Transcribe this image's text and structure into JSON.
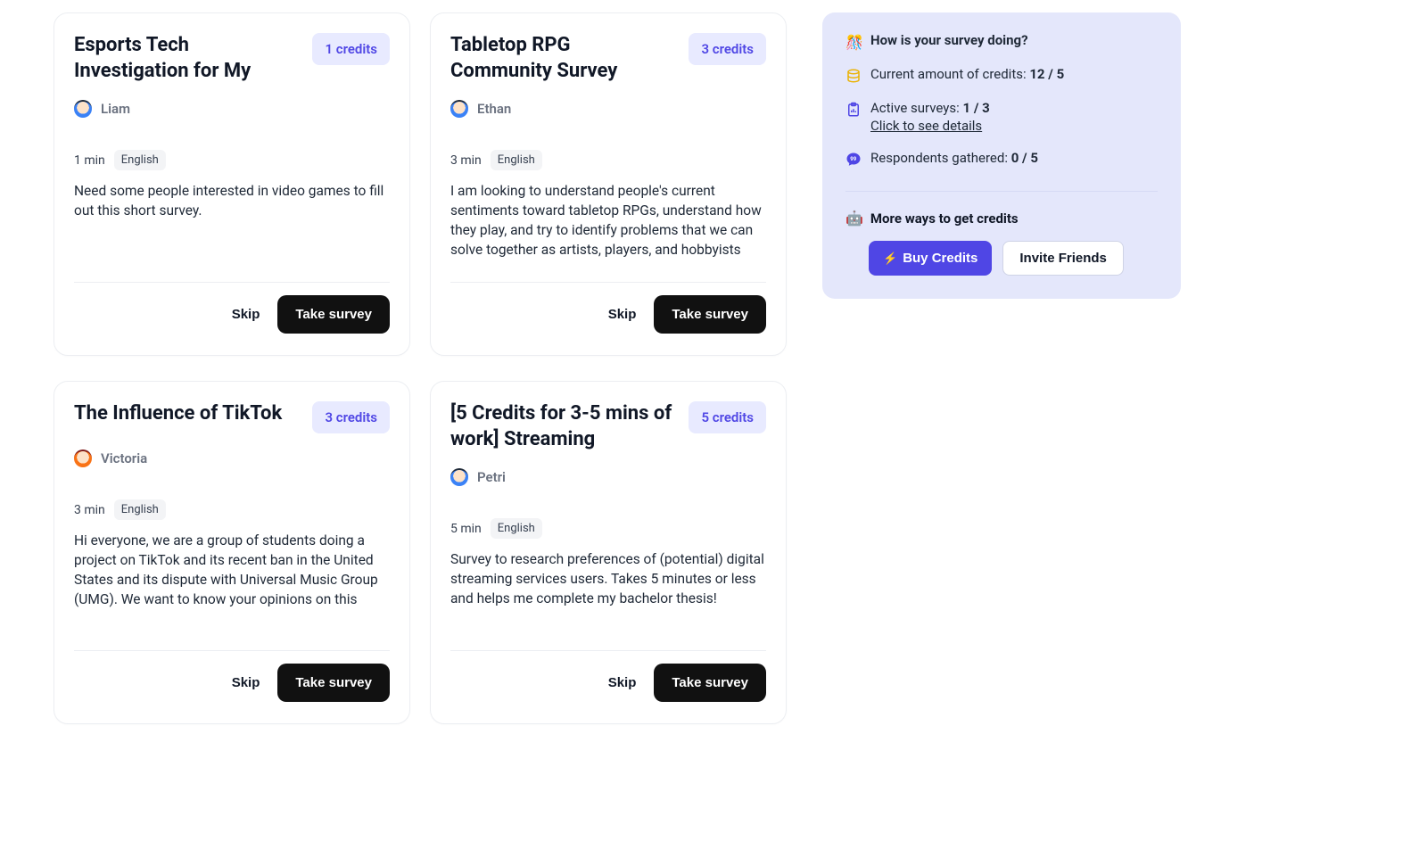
{
  "surveys": [
    {
      "title": "Esports Tech Investigation for My",
      "credits": "1 credits",
      "author": "Liam",
      "avatar": "male",
      "duration": "1 min",
      "language": "English",
      "description": "Need some people interested in video games to fill out this short survey.",
      "skip": "Skip",
      "take": "Take survey"
    },
    {
      "title": "Tabletop RPG Community Survey",
      "credits": "3 credits",
      "author": "Ethan",
      "avatar": "male",
      "duration": "3 min",
      "language": "English",
      "description": "I am looking to understand people's current sentiments toward tabletop RPGs, understand how they play, and try to identify problems that we can solve together as artists, players, and hobbyists",
      "skip": "Skip",
      "take": "Take survey"
    },
    {
      "title": "The Influence of TikTok",
      "credits": "3 credits",
      "author": "Victoria",
      "avatar": "female",
      "duration": "3 min",
      "language": "English",
      "description": "Hi everyone, we are a group of students doing a project on TikTok and its recent ban in the United States and its dispute with Universal Music Group (UMG). We want to know your opinions on this",
      "skip": "Skip",
      "take": "Take survey"
    },
    {
      "title": "[5 Credits for 3-5 mins of work] Streaming",
      "credits": "5 credits",
      "author": "Petri",
      "avatar": "male",
      "duration": "5 min",
      "language": "English",
      "description": "Survey to research preferences of (potential) digital streaming services users. Takes 5 minutes or less and helps me complete my bachelor thesis!",
      "skip": "Skip",
      "take": "Take survey"
    }
  ],
  "sidebar": {
    "title": "How is your survey doing?",
    "credits_label": "Current amount of credits: ",
    "credits_value": "12 / 5",
    "active_label": "Active surveys: ",
    "active_value": "1 / 3",
    "details_link": "Click to see details",
    "respondents_label": "Respondents gathered: ",
    "respondents_value": "0 / 5",
    "more_title": "More ways to get credits",
    "buy_label": "Buy Credits",
    "invite_label": "Invite Friends"
  }
}
